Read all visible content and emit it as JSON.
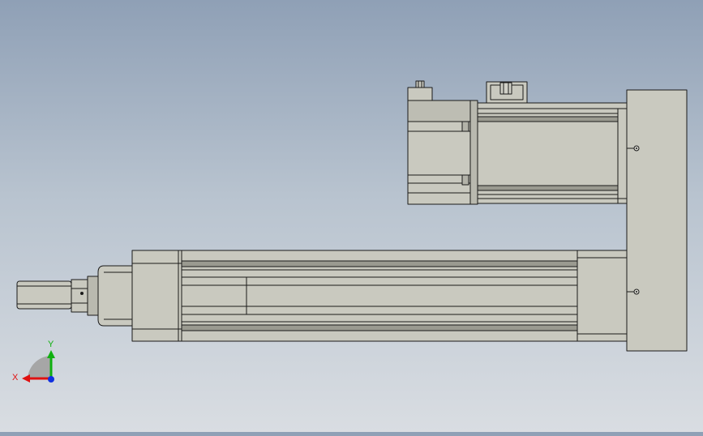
{
  "viewport": {
    "background_top": "#8fa0b6",
    "background_bottom": "#d9dde2"
  },
  "model": {
    "part_fill": "#c9c9bf",
    "part_shade": "#b3b3a9",
    "edge_color": "#1a1a1a",
    "components": [
      "actuator-cylinder",
      "servo-motor",
      "mounting-plate",
      "piston-rod"
    ]
  },
  "triad": {
    "x_label": "X",
    "y_label": "Y",
    "x_color": "#e01010",
    "y_color": "#10b010",
    "z_color": "#1030e0"
  }
}
